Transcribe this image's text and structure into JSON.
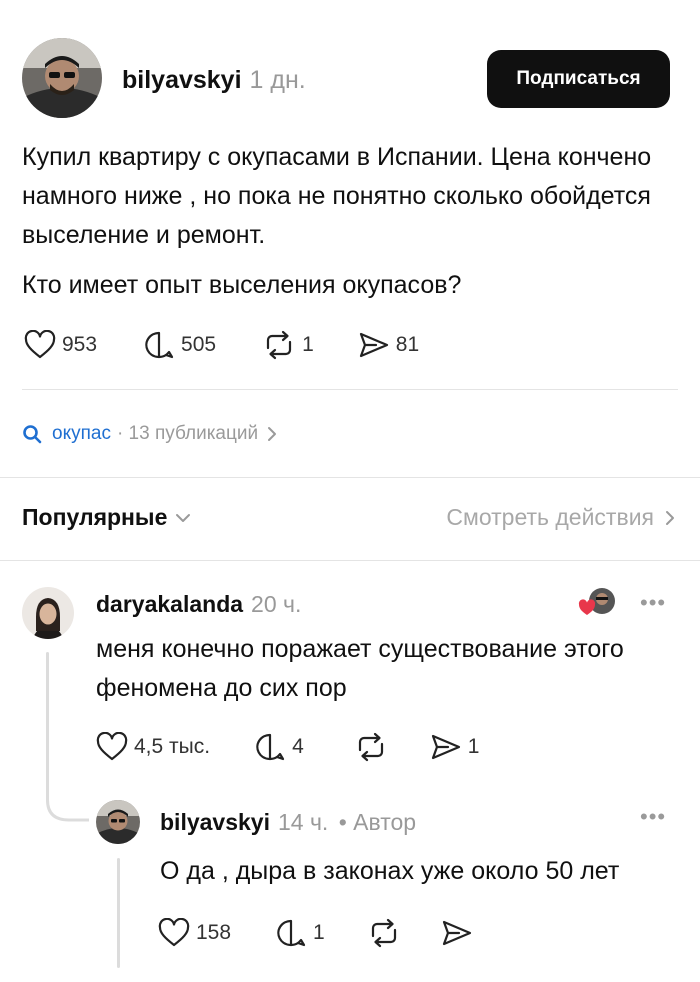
{
  "post": {
    "username": "bilyavskyi",
    "time": "1 дн.",
    "follow_label": "Подписаться",
    "paragraph1": "Купил квартиру с окупасами в Испании. Цена кончено намного ниже , но пока не понятно сколько обойдется выселение и ремонт.",
    "paragraph2": "Кто имеет опыт выселения окупасов?",
    "likes": "953",
    "replies": "505",
    "reposts": "1",
    "shares": "81"
  },
  "topic": {
    "tag": "окупас",
    "count": "· 13 публикаций"
  },
  "comments_header": {
    "sort_label": "Популярные",
    "activity_label": "Смотреть действия"
  },
  "comment1": {
    "username": "daryakalanda",
    "time": "20 ч.",
    "text": "меня конечно поражает существование этого феномена до сих пор",
    "likes": "4,5 тыс.",
    "replies": "4",
    "shares": "1",
    "more": "•••"
  },
  "reply1": {
    "username": "bilyavskyi",
    "time": "14 ч.",
    "author_badge": "• Автор",
    "text": "О да , дыра в законах уже около 50 лет",
    "likes": "158",
    "replies": "1",
    "more": "•••"
  },
  "colors": {
    "accent": "#1f6fd1",
    "like_red": "#e8374b",
    "muted": "#999999",
    "button_bg": "#101010"
  },
  "icons": [
    "heart-icon",
    "comment-icon",
    "repost-icon",
    "share-icon",
    "search-icon",
    "chevron-right-icon",
    "chevron-down-icon"
  ]
}
